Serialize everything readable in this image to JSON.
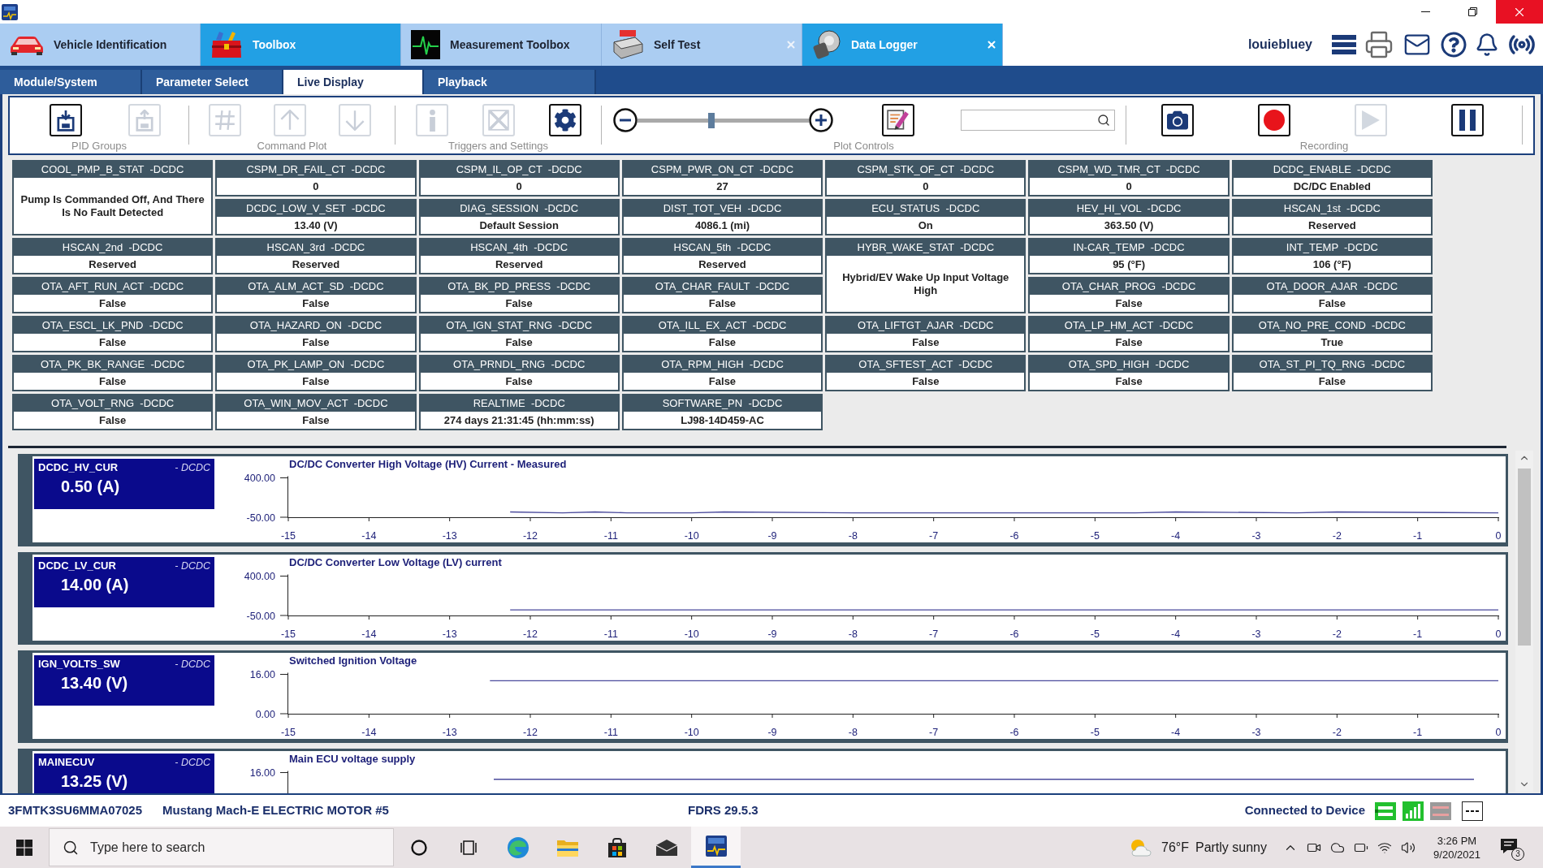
{
  "main_tabs": [
    {
      "label": "Vehicle Identification",
      "kind": "vehicle",
      "selected": false,
      "closable": false
    },
    {
      "label": "Toolbox",
      "kind": "toolbox",
      "selected": true,
      "closable": false
    },
    {
      "label": "Measurement Toolbox",
      "kind": "measurement",
      "selected": false,
      "closable": false
    },
    {
      "label": "Self Test",
      "kind": "self_test",
      "selected": false,
      "closable": true
    },
    {
      "label": "Data Logger",
      "kind": "data_logger",
      "selected": true,
      "closable": true
    }
  ],
  "user": {
    "name": "louiebluey"
  },
  "sub_tabs": [
    {
      "label": "Module/System",
      "selected": false
    },
    {
      "label": "Parameter Select",
      "selected": false
    },
    {
      "label": "Live Display",
      "selected": true
    },
    {
      "label": "Playback",
      "selected": false
    }
  ],
  "toolbar": {
    "groups": [
      {
        "label": "PID Groups",
        "items": [
          {
            "kind": "save",
            "disabled": false
          },
          {
            "kind": "load",
            "disabled": true
          }
        ]
      },
      {
        "label": "Command Plot",
        "items": [
          {
            "kind": "hash",
            "disabled": true
          },
          {
            "kind": "up",
            "disabled": true
          },
          {
            "kind": "down",
            "disabled": true
          }
        ]
      },
      {
        "label": "Triggers and Settings",
        "items": [
          {
            "kind": "info",
            "disabled": true
          },
          {
            "kind": "clear",
            "disabled": true
          },
          {
            "kind": "settings",
            "disabled": false
          }
        ]
      },
      {
        "label": "Plot Controls",
        "items": [
          {
            "kind": "zoom_out",
            "disabled": false
          },
          {
            "kind": "zoom_slider",
            "disabled": false,
            "level": 0.43
          },
          {
            "kind": "zoom_in",
            "disabled": false
          },
          {
            "kind": "edit_plot",
            "disabled": false
          },
          {
            "kind": "search",
            "disabled": false
          }
        ]
      },
      {
        "label": "Recording",
        "items": [
          {
            "kind": "camera",
            "disabled": false
          },
          {
            "kind": "record",
            "disabled": false
          },
          {
            "kind": "play",
            "disabled": true
          },
          {
            "kind": "pause",
            "disabled": false
          }
        ]
      }
    ]
  },
  "pids": [
    {
      "name": "COOL_PMP_B_STAT",
      "module": "-DCDC",
      "value": "Pump Is Commanded Off, And There Is No Fault Detected",
      "kind": "tall"
    },
    {
      "name": "CSPM_DR_FAIL_CT",
      "module": "-DCDC",
      "value": "0",
      "kind": "standard"
    },
    {
      "name": "CSPM_IL_OP_CT",
      "module": "-DCDC",
      "value": "0",
      "kind": "standard"
    },
    {
      "name": "CSPM_PWR_ON_CT",
      "module": "-DCDC",
      "value": "27",
      "kind": "standard"
    },
    {
      "name": "CSPM_STK_OF_CT",
      "module": "-DCDC",
      "value": "0",
      "kind": "standard"
    },
    {
      "name": "CSPM_WD_TMR_CT",
      "module": "-DCDC",
      "value": "0",
      "kind": "standard"
    },
    {
      "name": "DCDC_ENABLE",
      "module": "-DCDC",
      "value": "DC/DC Enabled",
      "kind": "standard"
    },
    {
      "name": "DCDC_LOW_V_SET",
      "module": "-DCDC",
      "value": "13.40 (V)",
      "kind": "standard"
    },
    {
      "name": "DIAG_SESSION",
      "module": "-DCDC",
      "value": "Default Session",
      "kind": "standard"
    },
    {
      "name": "DIST_TOT_VEH",
      "module": "-DCDC",
      "value": "4086.1 (mi)",
      "kind": "standard"
    },
    {
      "name": "ECU_STATUS",
      "module": "-DCDC",
      "value": "On",
      "kind": "standard"
    },
    {
      "name": "HEV_HI_VOL",
      "module": "-DCDC",
      "value": "363.50 (V)",
      "kind": "standard"
    },
    {
      "name": "HSCAN_1st",
      "module": "-DCDC",
      "value": "Reserved",
      "kind": "standard"
    },
    {
      "name": "HSCAN_2nd",
      "module": "-DCDC",
      "value": "Reserved",
      "kind": "standard"
    },
    {
      "name": "HSCAN_3rd",
      "module": "-DCDC",
      "value": "Reserved",
      "kind": "standard"
    },
    {
      "name": "HSCAN_4th",
      "module": "-DCDC",
      "value": "Reserved",
      "kind": "standard"
    },
    {
      "name": "HSCAN_5th",
      "module": "-DCDC",
      "value": "Reserved",
      "kind": "standard"
    },
    {
      "name": "HYBR_WAKE_STAT",
      "module": "-DCDC",
      "value": "Hybrid/EV Wake Up Input Voltage High",
      "kind": "tall"
    },
    {
      "name": "IN-CAR_TEMP",
      "module": "-DCDC",
      "value": "95 (°F)",
      "kind": "standard"
    },
    {
      "name": "INT_TEMP",
      "module": "-DCDC",
      "value": "106 (°F)",
      "kind": "standard"
    },
    {
      "name": "OTA_AFT_RUN_ACT",
      "module": "-DCDC",
      "value": "False",
      "kind": "standard"
    },
    {
      "name": "OTA_ALM_ACT_SD",
      "module": "-DCDC",
      "value": "False",
      "kind": "standard"
    },
    {
      "name": "OTA_BK_PD_PRESS",
      "module": "-DCDC",
      "value": "False",
      "kind": "standard"
    },
    {
      "name": "OTA_CHAR_FAULT",
      "module": "-DCDC",
      "value": "False",
      "kind": "standard"
    },
    {
      "name": "OTA_CHAR_PROG",
      "module": "-DCDC",
      "value": "False",
      "kind": "standard"
    },
    {
      "name": "OTA_DOOR_AJAR",
      "module": "-DCDC",
      "value": "False",
      "kind": "standard"
    },
    {
      "name": "OTA_ESCL_LK_PND",
      "module": "-DCDC",
      "value": "False",
      "kind": "standard"
    },
    {
      "name": "OTA_HAZARD_ON",
      "module": "-DCDC",
      "value": "False",
      "kind": "standard"
    },
    {
      "name": "OTA_IGN_STAT_RNG",
      "module": "-DCDC",
      "value": "False",
      "kind": "standard"
    },
    {
      "name": "OTA_ILL_EX_ACT",
      "module": "-DCDC",
      "value": "False",
      "kind": "standard"
    },
    {
      "name": "OTA_LIFTGT_AJAR",
      "module": "-DCDC",
      "value": "False",
      "kind": "standard"
    },
    {
      "name": "OTA_LP_HM_ACT",
      "module": "-DCDC",
      "value": "False",
      "kind": "standard"
    },
    {
      "name": "OTA_NO_PRE_COND",
      "module": "-DCDC",
      "value": "True",
      "kind": "standard"
    },
    {
      "name": "OTA_PK_BK_RANGE",
      "module": "-DCDC",
      "value": "False",
      "kind": "standard"
    },
    {
      "name": "OTA_PK_LAMP_ON",
      "module": "-DCDC",
      "value": "False",
      "kind": "standard"
    },
    {
      "name": "OTA_PRNDL_RNG",
      "module": "-DCDC",
      "value": "False",
      "kind": "standard"
    },
    {
      "name": "OTA_RPM_HIGH",
      "module": "-DCDC",
      "value": "False",
      "kind": "standard"
    },
    {
      "name": "OTA_SFTEST_ACT",
      "module": "-DCDC",
      "value": "False",
      "kind": "standard"
    },
    {
      "name": "OTA_SPD_HIGH",
      "module": "-DCDC",
      "value": "False",
      "kind": "standard"
    },
    {
      "name": "OTA_ST_PI_TQ_RNG",
      "module": "-DCDC",
      "value": "False",
      "kind": "standard"
    },
    {
      "name": "OTA_VOLT_RNG",
      "module": "-DCDC",
      "value": "False",
      "kind": "standard"
    },
    {
      "name": "OTA_WIN_MOV_ACT",
      "module": "-DCDC",
      "value": "False",
      "kind": "standard"
    },
    {
      "name": "REALTIME",
      "module": "-DCDC",
      "value": "274 days 21:31:45 (hh:mm:ss)",
      "kind": "standard"
    },
    {
      "name": "SOFTWARE_PN",
      "module": "-DCDC",
      "value": "LJ98-14D459-AC",
      "kind": "standard"
    }
  ],
  "plots": [
    {
      "name": "DCDC_HV_CUR",
      "module": "- DCDC",
      "reading": "0.50 (A)",
      "chart_data": {
        "type": "line",
        "title": "DC/DC Converter High Voltage (HV) Current - Measured",
        "x": [
          -12.25,
          -11.6,
          -11.2,
          -10.8,
          -10,
          -9.6,
          -8,
          -4.5,
          -4,
          -2.5,
          -2,
          0
        ],
        "series": [
          {
            "color": "#4a4a9c",
            "values": [
              10,
              0,
              10,
              0,
              0,
              10,
              0,
              0,
              10,
              0,
              10,
              0
            ]
          }
        ],
        "xlim": [
          -15,
          0
        ],
        "ylim": [
          -50,
          400
        ],
        "xticks": [
          -15,
          -14,
          -13,
          -12,
          -11,
          -10,
          -9,
          -8,
          -7,
          -6,
          -5,
          -4,
          -3,
          -2,
          -1,
          0
        ],
        "yticks": [
          {
            "value": 400,
            "label": "400.00"
          },
          {
            "value": -50,
            "label": "-50.00"
          }
        ]
      }
    },
    {
      "name": "DCDC_LV_CUR",
      "module": "- DCDC",
      "reading": "14.00 (A)",
      "chart_data": {
        "type": "line",
        "title": "DC/DC Converter Low Voltage (LV) current",
        "x": [
          -12.25,
          0
        ],
        "series": [
          {
            "color": "#4a4a9c",
            "values": [
              14,
              14
            ]
          }
        ],
        "xlim": [
          -15,
          0
        ],
        "ylim": [
          -50,
          400
        ],
        "xticks": [
          -15,
          -14,
          -13,
          -12,
          -11,
          -10,
          -9,
          -8,
          -7,
          -6,
          -5,
          -4,
          -3,
          -2,
          -1,
          0
        ],
        "yticks": [
          {
            "value": 400,
            "label": "400.00"
          },
          {
            "value": -50,
            "label": "-50.00"
          }
        ]
      }
    },
    {
      "name": "IGN_VOLTS_SW",
      "module": "- DCDC",
      "reading": "13.40 (V)",
      "chart_data": {
        "type": "line",
        "title": "Switched Ignition Voltage",
        "x": [
          -12.5,
          0
        ],
        "series": [
          {
            "color": "#4a4a9c",
            "values": [
              13.4,
              13.4
            ]
          }
        ],
        "xlim": [
          -15,
          0
        ],
        "ylim": [
          0,
          16
        ],
        "xticks": [
          -15,
          -14,
          -13,
          -12,
          -11,
          -10,
          -9,
          -8,
          -7,
          -6,
          -5,
          -4,
          -3,
          -2,
          -1,
          0
        ],
        "yticks": [
          {
            "value": 16,
            "label": "16.00"
          },
          {
            "value": 0,
            "label": "0.00"
          }
        ]
      }
    },
    {
      "name": "MAINECUV",
      "module": "- DCDC",
      "reading": "13.25 (V)",
      "graph": {
        "title": "Main ECU voltage supply",
        "tick_label": "16.00"
      }
    }
  ],
  "status_bar": {
    "vin": "3FMTK3SU6MMA07025",
    "vehicle": "Mustang Mach-E ELECTRIC MOTOR #5",
    "version": "FDRS 29.5.3",
    "connection": "Connected to Device"
  },
  "taskbar": {
    "search": {
      "placeholder": "Type here to search"
    },
    "apps": [
      {
        "kind": "cortana",
        "selected": false
      },
      {
        "kind": "task_view",
        "selected": false
      },
      {
        "kind": "edge",
        "selected": false
      },
      {
        "kind": "explorer",
        "selected": false
      },
      {
        "kind": "store",
        "selected": false
      },
      {
        "kind": "mail",
        "selected": false
      },
      {
        "kind": "fdrs",
        "selected": true
      }
    ],
    "weather": {
      "temperature": "76°F",
      "condition": "Partly sunny"
    },
    "time": "3:26 PM",
    "date": "9/20/2021",
    "notification_count": "3"
  }
}
